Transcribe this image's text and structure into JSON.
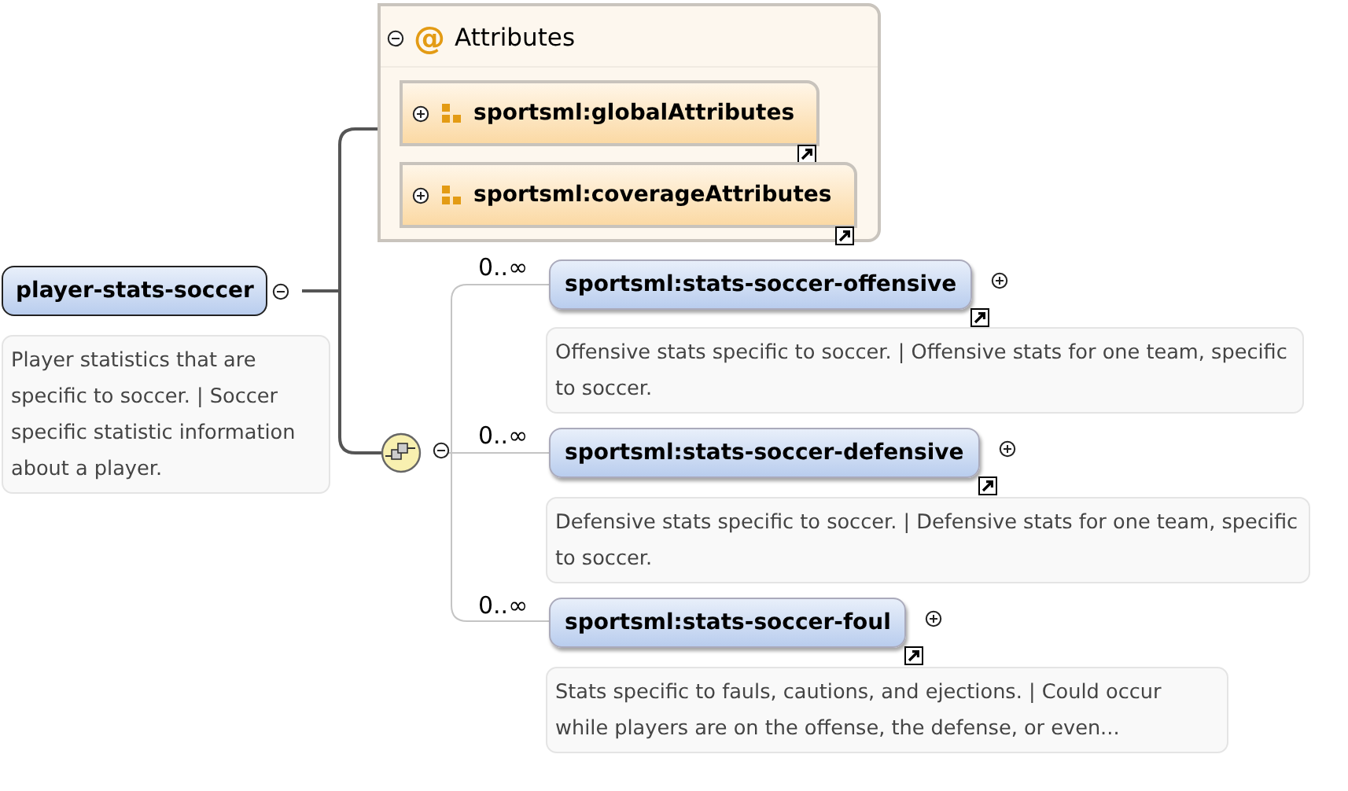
{
  "element": {
    "name": "player-stats-soccer",
    "expanded": true,
    "documentation": "Player statistics that are specific to soccer. | Soccer specific statistic information about a player."
  },
  "attributes": {
    "symbol": "@",
    "title": "Attributes",
    "expanded": true,
    "groups": [
      {
        "name": "sportsml:globalAttributes",
        "expanded": false,
        "reference": true
      },
      {
        "name": "sportsml:coverageAttributes",
        "expanded": false,
        "reference": true
      }
    ]
  },
  "sequence": {
    "expanded": true,
    "children": [
      {
        "name": "sportsml:stats-soccer-offensive",
        "cardinality": "0..∞",
        "expanded": false,
        "reference": true,
        "documentation": "Offensive stats specific to soccer. | Offensive stats for one team, specific to soccer."
      },
      {
        "name": "sportsml:stats-soccer-defensive",
        "cardinality": "0..∞",
        "expanded": false,
        "reference": true,
        "documentation": "Defensive stats specific to soccer. | Defensive stats for one team, specific to soccer."
      },
      {
        "name": "sportsml:stats-soccer-foul",
        "cardinality": "0..∞",
        "expanded": false,
        "reference": true,
        "documentation": "Stats specific to fauls, cautions, and ejections. | Could occur while players are on the offense, the defense, or even..."
      }
    ]
  }
}
